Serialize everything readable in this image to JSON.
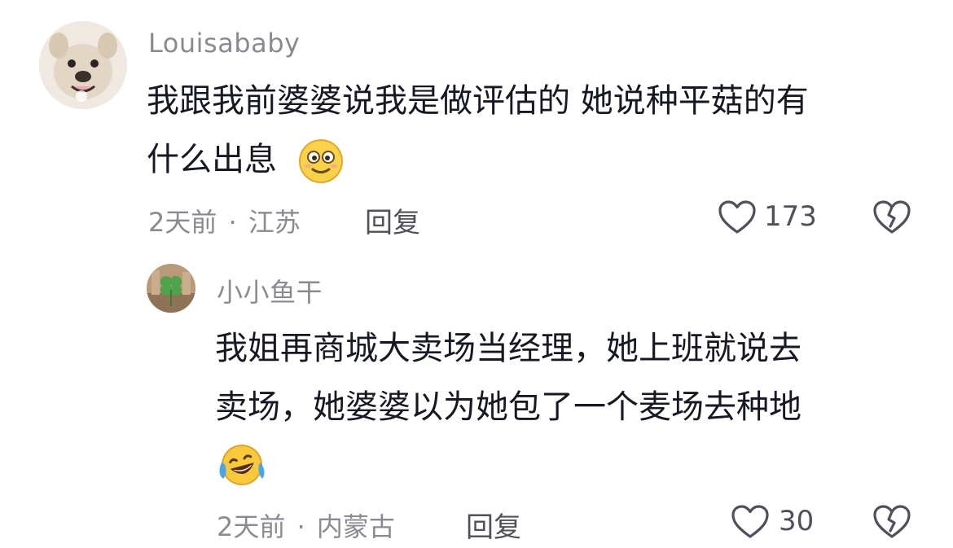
{
  "comments": [
    {
      "username": "Louisababy",
      "line1": "我跟我前婆婆说我是做评估的 她说种平菇的有",
      "line2": "什么出息",
      "emoji": "smiling-face-emoji",
      "time": "2天前",
      "separator": "·",
      "location": "江苏",
      "reply_label": "回复",
      "likes": "173",
      "like_icon": "heart-outline-icon",
      "dislike_icon": "broken-heart-icon"
    },
    {
      "username": "小小鱼干",
      "line1": "我姐再商城大卖场当经理，她上班就说去",
      "line2": "卖场，她婆婆以为她包了一个麦场去种地",
      "emoji": "laughing-with-tears-emoji",
      "time": "2天前",
      "separator": "·",
      "location": "内蒙古",
      "reply_label": "回复",
      "likes": "30",
      "like_icon": "heart-outline-icon",
      "dislike_icon": "broken-heart-icon"
    }
  ],
  "colors": {
    "username": "#8a8b91",
    "text": "#161823",
    "meta": "#8a8b91",
    "action": "#4f505a"
  }
}
